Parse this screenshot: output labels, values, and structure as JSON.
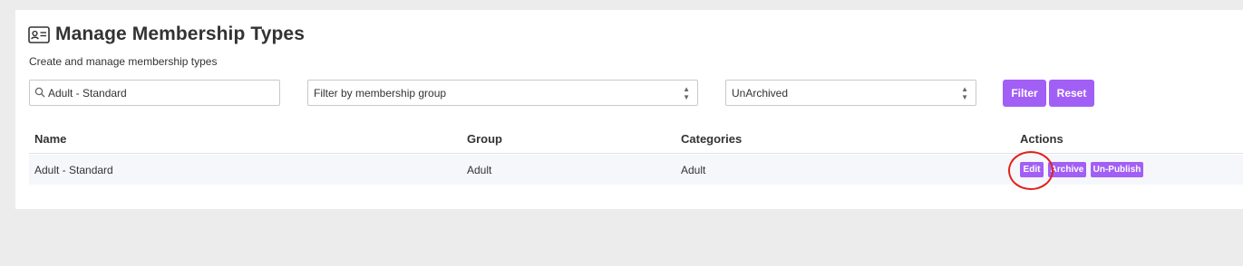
{
  "page": {
    "title": "Manage Membership Types",
    "subtitle": "Create and manage membership types",
    "title_icon": "id-card-icon"
  },
  "filters": {
    "search_value": "Adult - Standard",
    "search_icon": "search-icon",
    "group_select_value": "Filter by membership group",
    "archive_select_value": "UnArchived",
    "filter_label": "Filter",
    "reset_label": "Reset"
  },
  "table": {
    "headers": {
      "name": "Name",
      "group": "Group",
      "categories": "Categories",
      "actions": "Actions"
    },
    "rows": [
      {
        "name": "Adult - Standard",
        "group": "Adult",
        "categories": "Adult",
        "actions": [
          "Edit",
          "Archive",
          "Un-Publish"
        ]
      }
    ]
  },
  "colors": {
    "accent": "#a25ff5",
    "highlight": "#e2231a",
    "background": "#ececec",
    "row_background": "#f5f7fb"
  }
}
